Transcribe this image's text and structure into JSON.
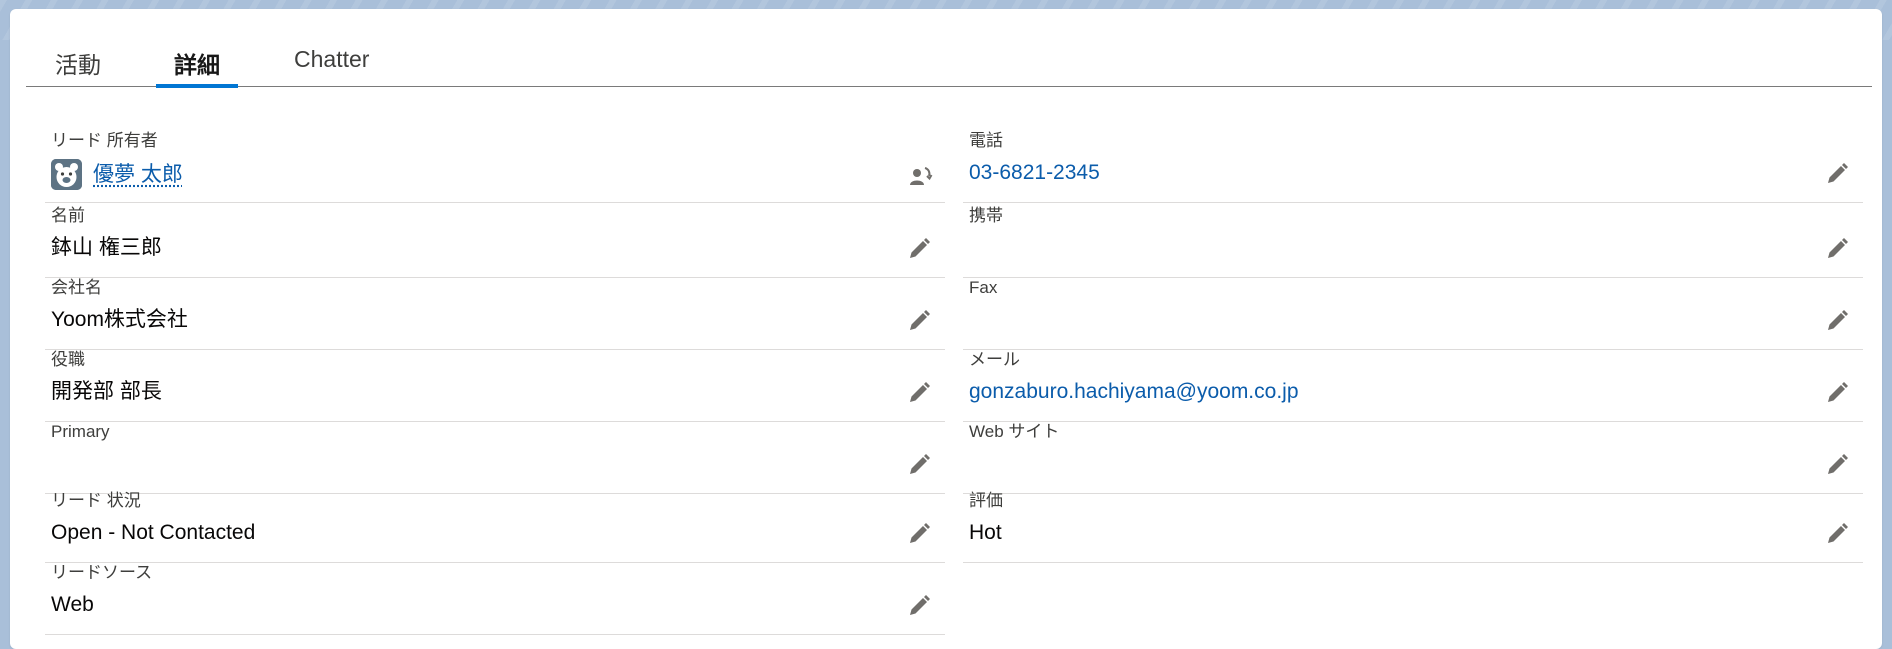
{
  "tabs": [
    {
      "label": "活動",
      "active": false
    },
    {
      "label": "詳細",
      "active": true
    },
    {
      "label": "Chatter",
      "active": false
    }
  ],
  "fields": {
    "owner": {
      "label": "リード 所有者",
      "value": "優夢 太郎"
    },
    "name": {
      "label": "名前",
      "value": "鉢山 権三郎"
    },
    "company": {
      "label": "会社名",
      "value": "Yoom株式会社"
    },
    "title": {
      "label": "役職",
      "value": "開発部 部長"
    },
    "primary": {
      "label": "Primary",
      "value": ""
    },
    "status": {
      "label": "リード 状況",
      "value": "Open - Not Contacted"
    },
    "source": {
      "label": "リードソース",
      "value": "Web"
    },
    "phone": {
      "label": "電話",
      "value": "03-6821-2345"
    },
    "mobile": {
      "label": "携帯",
      "value": ""
    },
    "fax": {
      "label": "Fax",
      "value": ""
    },
    "email": {
      "label": "メール",
      "value": "gonzaburo.hachiyama@yoom.co.jp"
    },
    "website": {
      "label": "Web サイト",
      "value": ""
    },
    "rating": {
      "label": "評価",
      "value": "Hot"
    }
  },
  "icons": {
    "edit": "pencil-icon",
    "change_owner": "change-owner-icon",
    "avatar": "bear-avatar-icon"
  },
  "colors": {
    "accent": "#0176d3",
    "link": "#0b5cab",
    "background": "#a9bfd9"
  }
}
